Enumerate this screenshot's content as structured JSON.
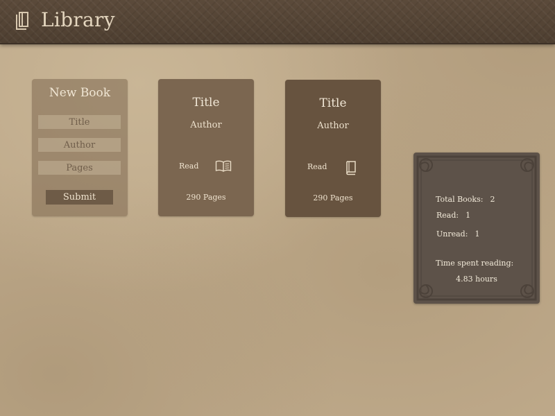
{
  "header": {
    "title": "Library",
    "icon": "books-icon"
  },
  "new_book_form": {
    "title": "New Book",
    "fields": {
      "title": {
        "placeholder": "Title",
        "value": ""
      },
      "author": {
        "placeholder": "Author",
        "value": ""
      },
      "pages": {
        "placeholder": "Pages",
        "value": ""
      }
    },
    "submit_label": "Submit"
  },
  "books": [
    {
      "title": "Title",
      "author": "Author",
      "read_label": "Read",
      "status_icon": "open-book-icon",
      "pages": "290 Pages"
    },
    {
      "title": "Title",
      "author": "Author",
      "read_label": "Read",
      "status_icon": "closed-book-icon",
      "pages": "290 Pages"
    }
  ],
  "stats": {
    "total_label": "Total Books:",
    "total_value": "2",
    "read_label": "Read:",
    "read_value": "1",
    "unread_label": "Unread:",
    "unread_value": "1",
    "time_label": "Time spent reading:",
    "time_value": "4.83 hours"
  },
  "colors": {
    "header": "#54443a",
    "background": "#bea98a",
    "card_light": "#7b6650",
    "card_dark": "#67533f",
    "stats_panel": "#5d5249",
    "submit_button": "#6e5b47"
  }
}
